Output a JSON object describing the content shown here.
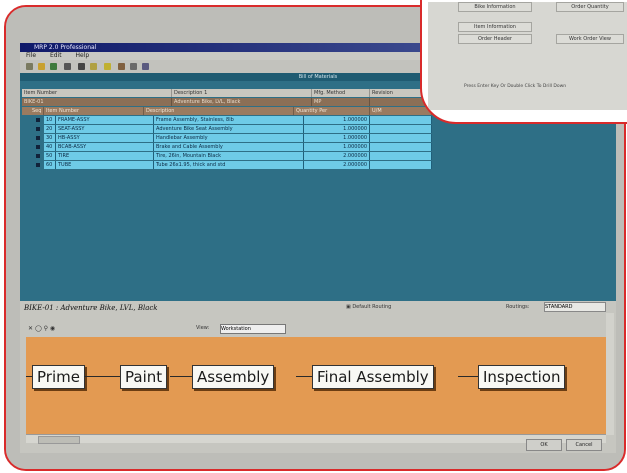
{
  "window": {
    "title": "MRP 2.0 Professional"
  },
  "menu": [
    "File",
    "Edit",
    "Help"
  ],
  "panel": {
    "header": "Bill of Materials"
  },
  "table": {
    "columns": [
      "Item Number",
      "Description 1",
      "Mfg. Method",
      "Revision"
    ],
    "parent": {
      "item": "BIKE-01",
      "description": "Adventure Bike, LVL, Black",
      "method": "MP"
    },
    "sub_columns": [
      "Seq",
      "Item Number",
      "Description",
      "Quantity Per",
      "U/M"
    ],
    "rows": [
      {
        "seq": "10",
        "item": "FRAME-ASSY",
        "desc": "Frame Assembly, Stainless, 8lb",
        "qty": "1.000000"
      },
      {
        "seq": "20",
        "item": "SEAT-ASSY",
        "desc": "Adventure Bike Seat Assembly",
        "qty": "1.000000"
      },
      {
        "seq": "30",
        "item": "HB-ASSY",
        "desc": "Handlebar Assembly",
        "qty": "1.000000"
      },
      {
        "seq": "40",
        "item": "BCAB-ASSY",
        "desc": "Brake and Cable Assembly",
        "qty": "1.000000"
      },
      {
        "seq": "50",
        "item": "TIRE",
        "desc": "Tire, 26in, Mountain Black",
        "qty": "2.000000"
      },
      {
        "seq": "60",
        "item": "TUBE",
        "desc": "Tube 26x1.95, thick and std",
        "qty": "2.000000"
      }
    ]
  },
  "routing": {
    "title": "BIKE-01 : Adventure Bike, LVL, Black",
    "default_label": "Default Routing",
    "routings_label": "Routings:",
    "routings_value": "STANDARD",
    "view_label": "View:",
    "view_value": "Workstation",
    "steps": [
      "Prime",
      "Paint",
      "Assembly",
      "Final Assembly",
      "Inspection"
    ],
    "ok_label": "OK",
    "cancel_label": "Cancel"
  },
  "inset": {
    "row1": [
      "Bike Information",
      "Order Quantity"
    ],
    "row2": [
      "Item Information"
    ],
    "row3": [
      "Order Header",
      "Work Order View"
    ],
    "status": "Press Enter Key Or Double Click To Drill Down"
  },
  "colors": {
    "accent_border": "#d92b2b",
    "panel": "#2e6f86",
    "flow_bg": "#e39a52"
  }
}
